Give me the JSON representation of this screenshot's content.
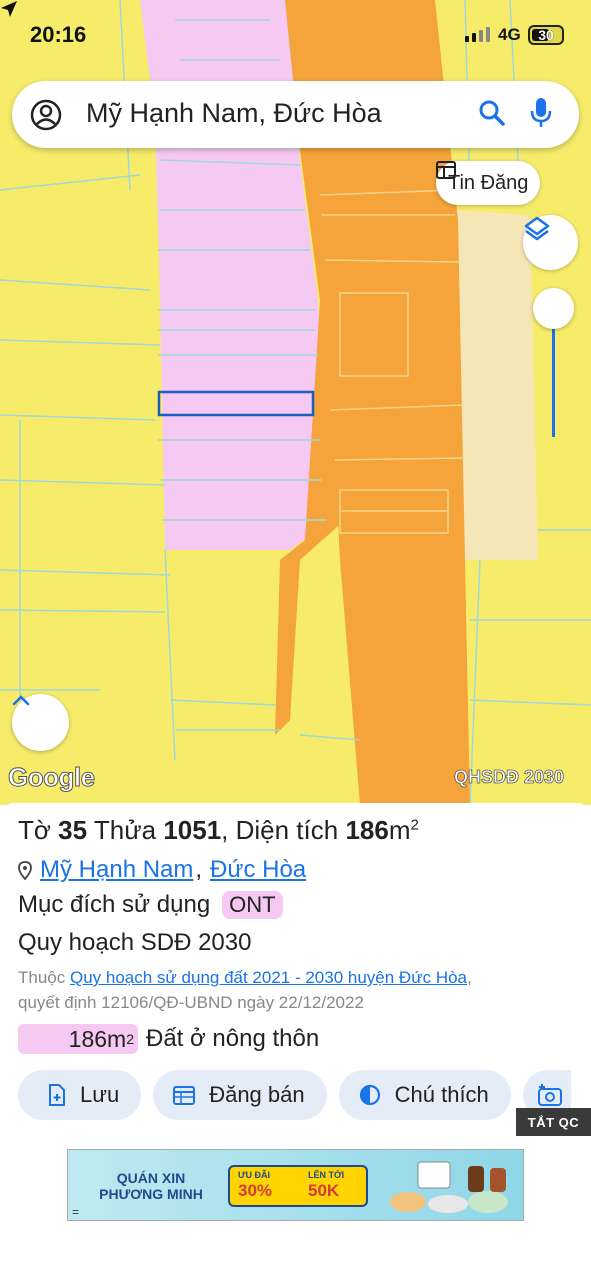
{
  "status": {
    "time": "20:16",
    "network": "4G",
    "battery": "30"
  },
  "search": {
    "query": "Mỹ Hạnh Nam, Đức Hòa"
  },
  "map": {
    "tin_dang_label": "Tin Đăng",
    "google_logo": "Google",
    "layer_tag": "QHSDĐ 2030",
    "colors": {
      "base": "#f7ec6a",
      "ont": "#f6c9f2",
      "road": "#f4a43a",
      "beige": "#f5e6b8",
      "highlight": "#1a5fbf"
    }
  },
  "parcel": {
    "to_label": "Tờ",
    "to_number": "35",
    "thua_label": "Thửa",
    "thua_number": "1051",
    "area_label": "Diện tích",
    "area_value": "186",
    "area_unit": "m",
    "area_unit_sup": "2",
    "commune": "Mỹ Hạnh Nam",
    "district": "Đức Hòa",
    "purpose_label": "Mục đích sử dụng",
    "purpose_code": "ONT",
    "plan_title": "Quy hoạch SDĐ 2030",
    "belongs_prefix": "Thuộc",
    "belongs_link": "Quy hoạch sử dụng đất 2021 - 2030 huyện Đức Hòa",
    "belongs_suffix": ",",
    "decision_text": "quyết định 12106/QĐ-UBND ngày 22/12/2022",
    "legend_area": "186m",
    "legend_area_sup": "2",
    "legend_label": "Đất ở nông thôn"
  },
  "actions": [
    {
      "label": "Lưu",
      "icon": "file-plus-icon"
    },
    {
      "label": "Đăng bán",
      "icon": "calendar-icon"
    },
    {
      "label": "Chú thích",
      "icon": "contrast-icon"
    }
  ],
  "ad_close_label": "TẮT QC",
  "ad": {
    "title": "QUÁN XIN PHƯƠNG MINH",
    "discount_label": "ƯU ĐÃI",
    "discount_value": "30%",
    "max_label": "LÊN TỚI",
    "max_value": "50K"
  }
}
